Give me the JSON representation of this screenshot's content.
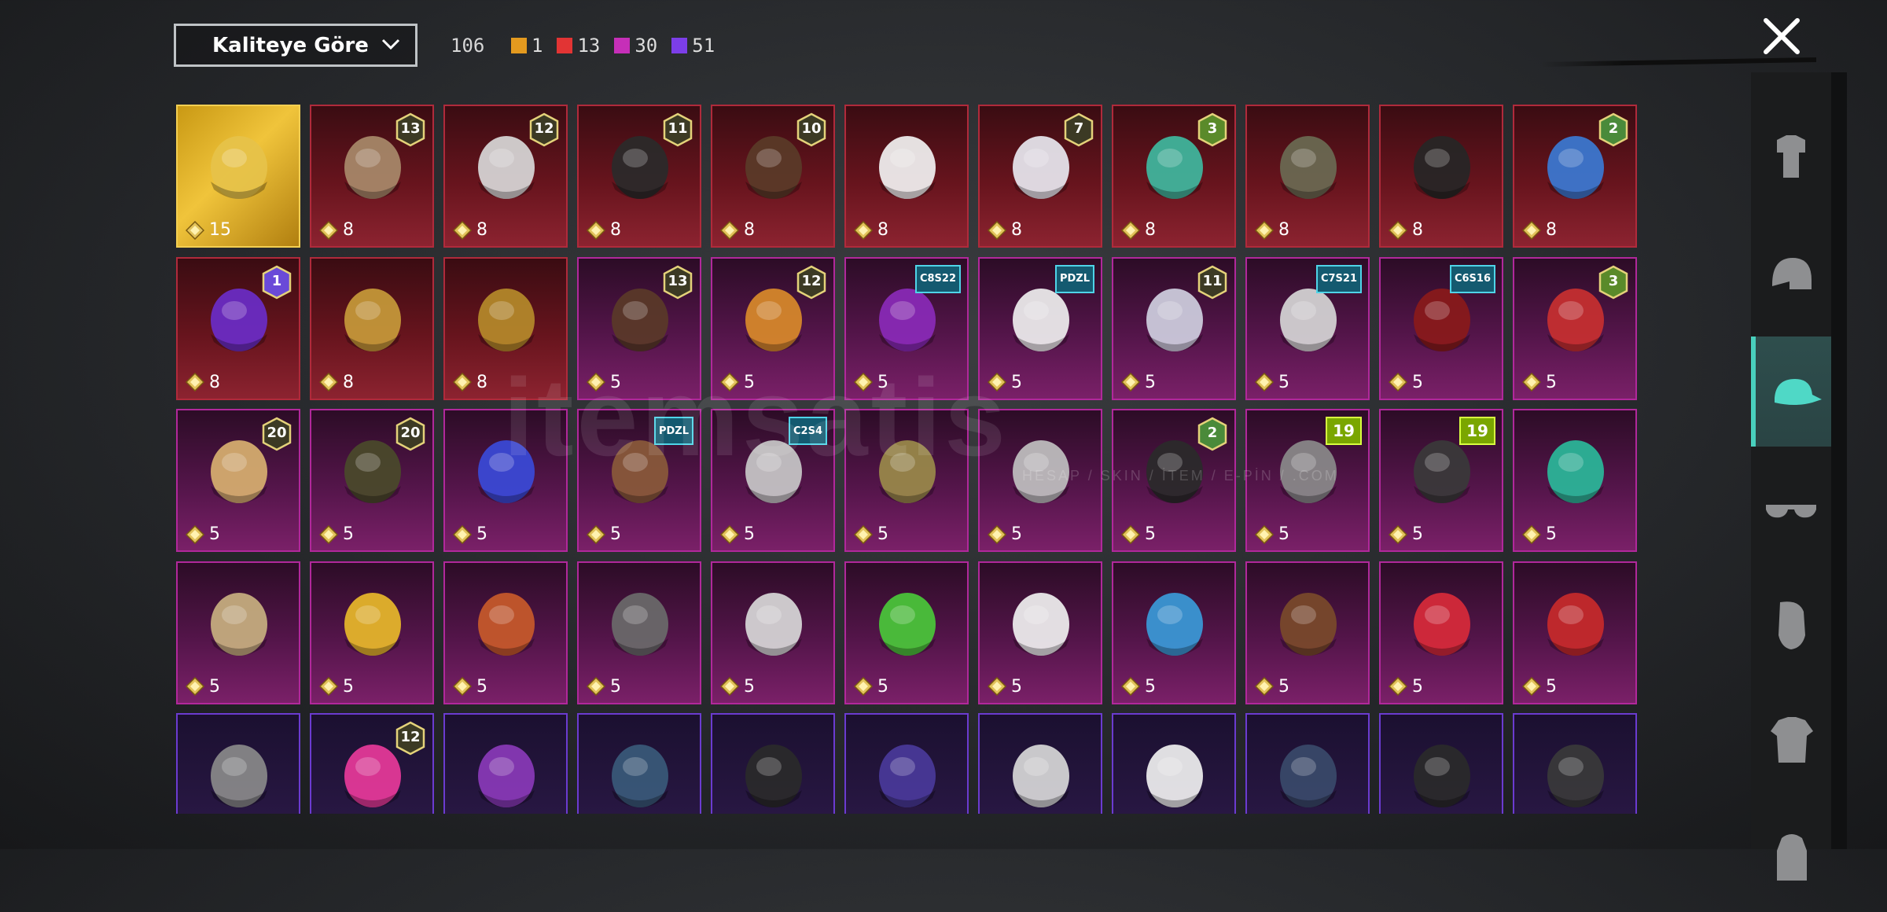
{
  "filter": {
    "sort_label": "Kaliteye Göre",
    "total": "106"
  },
  "legend": [
    {
      "color": "#e49a1f",
      "count": "1"
    },
    {
      "color": "#e23434",
      "count": "13"
    },
    {
      "color": "#c62fb8",
      "count": "30"
    },
    {
      "color": "#7c3ee8",
      "count": "51"
    }
  ],
  "watermark": {
    "text": "itemsatis",
    "sub": "HESAP / SKIN / İTEM / E-PİN / .COM"
  },
  "items": [
    {
      "r": "gold",
      "n": "15",
      "b": "",
      "t": "",
      "icon": "legendary-hat-icon",
      "tint": "#e6c24a"
    },
    {
      "r": "red",
      "n": "8",
      "b": "13",
      "t": "",
      "icon": "hat-with-hair-icon",
      "tint": "#a88a6a"
    },
    {
      "r": "red",
      "n": "8",
      "b": "12",
      "t": "",
      "icon": "white-hair-icon",
      "tint": "#d8d8d8"
    },
    {
      "r": "red",
      "n": "8",
      "b": "11",
      "t": "",
      "icon": "black-helmet-icon",
      "tint": "#2a2a2a"
    },
    {
      "r": "red",
      "n": "8",
      "b": "10",
      "t": "",
      "icon": "brown-hair-icon",
      "tint": "#5a3b28"
    },
    {
      "r": "red",
      "n": "8",
      "b": "",
      "t": "",
      "icon": "cowboy-hat-icon",
      "tint": "#f2f2f2"
    },
    {
      "r": "red",
      "n": "8",
      "b": "7",
      "t": "",
      "icon": "white-hair-icon",
      "tint": "#e8e8f0"
    },
    {
      "r": "red",
      "n": "8",
      "b": "3",
      "t": "",
      "icon": "green-hair-mask-icon",
      "tint": "#3fb8a0"
    },
    {
      "r": "red",
      "n": "8",
      "b": "",
      "t": "",
      "icon": "horned-helmet-icon",
      "tint": "#6a6a52"
    },
    {
      "r": "red",
      "n": "8",
      "b": "",
      "t": "",
      "icon": "dark-helmet-icon",
      "tint": "#262626"
    },
    {
      "r": "red",
      "n": "8",
      "b": "2",
      "t": "",
      "icon": "blue-helmet-icon",
      "tint": "#3b7ad4"
    },
    {
      "r": "red",
      "n": "8",
      "b": "1",
      "t": "",
      "icon": "purple-mask-icon",
      "tint": "#6a2cc8"
    },
    {
      "r": "red",
      "n": "8",
      "b": "",
      "t": "",
      "icon": "gold-helmet-icon",
      "tint": "#c79a3a"
    },
    {
      "r": "red",
      "n": "8",
      "b": "",
      "t": "",
      "icon": "gold-helmet-icon",
      "tint": "#b58a2a"
    },
    {
      "r": "pink",
      "n": "5",
      "b": "13",
      "t": "",
      "icon": "goggles-hat-icon",
      "tint": "#5a3a28"
    },
    {
      "r": "pink",
      "n": "5",
      "b": "12",
      "t": "",
      "icon": "orange-hair-icon",
      "tint": "#d98a2a"
    },
    {
      "r": "pink",
      "n": "5",
      "b": "",
      "t": "C8S22",
      "icon": "purple-hair-icon",
      "tint": "#8a2ab8"
    },
    {
      "r": "pink",
      "n": "5",
      "b": "",
      "t": "PDZL",
      "icon": "panda-mask-icon",
      "tint": "#efefef"
    },
    {
      "r": "pink",
      "n": "5",
      "b": "11",
      "t": "",
      "icon": "flower-hair-icon",
      "tint": "#cfcfdf"
    },
    {
      "r": "pink",
      "n": "5",
      "b": "",
      "t": "C7S21",
      "icon": "silver-hair-icon",
      "tint": "#d6d6d6"
    },
    {
      "r": "pink",
      "n": "5",
      "b": "",
      "t": "C6S16",
      "icon": "red-hair-icon",
      "tint": "#8a1a1a"
    },
    {
      "r": "pink",
      "n": "5",
      "b": "3",
      "t": "",
      "icon": "jester-hat-icon",
      "tint": "#c83030"
    },
    {
      "r": "pink",
      "n": "5",
      "b": "20",
      "t": "",
      "icon": "blonde-hair-icon",
      "tint": "#d8b070"
    },
    {
      "r": "pink",
      "n": "5",
      "b": "20",
      "t": "",
      "icon": "gold-mask-icon",
      "tint": "#4a4a2a"
    },
    {
      "r": "pink",
      "n": "5",
      "b": "",
      "t": "",
      "icon": "blue-beast-mask-icon",
      "tint": "#3a4ad8"
    },
    {
      "r": "pink",
      "n": "5",
      "b": "",
      "t": "PDZL",
      "icon": "gas-mask-icon",
      "tint": "#8a5a3a"
    },
    {
      "r": "pink",
      "n": "5",
      "b": "",
      "t": "C2S4",
      "icon": "silver-hair-icon",
      "tint": "#c8c8c8"
    },
    {
      "r": "pink",
      "n": "5",
      "b": "",
      "t": "",
      "icon": "brass-helmet-icon",
      "tint": "#9a8a4a"
    },
    {
      "r": "pink",
      "n": "5",
      "b": "",
      "t": "",
      "icon": "grey-hair-icon",
      "tint": "#c0c0c0"
    },
    {
      "r": "pink",
      "n": "5",
      "b": "2",
      "t": "",
      "icon": "tentacle-mask-icon",
      "tint": "#2a2a2a"
    },
    {
      "r": "pink",
      "n": "5",
      "b": "",
      "t": "19",
      "icon": "grey-hair-icon",
      "tint": "#8a8a8a"
    },
    {
      "r": "pink",
      "n": "5",
      "b": "",
      "t": "19",
      "icon": "goggle-helmet-icon",
      "tint": "#3a3a3a"
    },
    {
      "r": "pink",
      "n": "5",
      "b": "",
      "t": "",
      "icon": "teal-hat-icon",
      "tint": "#2ab89a"
    },
    {
      "r": "pink",
      "n": "5",
      "b": "",
      "t": "",
      "icon": "gold-mask-icon",
      "tint": "#c8b080"
    },
    {
      "r": "pink",
      "n": "5",
      "b": "",
      "t": "",
      "icon": "yellow-helmet-icon",
      "tint": "#e8b82a"
    },
    {
      "r": "pink",
      "n": "5",
      "b": "",
      "t": "",
      "icon": "bandana-icon",
      "tint": "#c85a2a"
    },
    {
      "r": "pink",
      "n": "5",
      "b": "",
      "t": "",
      "icon": "skull-dreadlocks-icon",
      "tint": "#6a6a6a"
    },
    {
      "r": "pink",
      "n": "5",
      "b": "",
      "t": "",
      "icon": "jester-mask-icon",
      "tint": "#d8d8d8"
    },
    {
      "r": "pink",
      "n": "5",
      "b": "",
      "t": "",
      "icon": "frog-mask-icon",
      "tint": "#4ac83a"
    },
    {
      "r": "pink",
      "n": "5",
      "b": "",
      "t": "",
      "icon": "beanie-icon",
      "tint": "#f0f0f0"
    },
    {
      "r": "pink",
      "n": "5",
      "b": "",
      "t": "",
      "icon": "blue-feather-mask-icon",
      "tint": "#3a9ad8"
    },
    {
      "r": "pink",
      "n": "5",
      "b": "",
      "t": "",
      "icon": "horns-headband-icon",
      "tint": "#7a4a2a"
    },
    {
      "r": "pink",
      "n": "5",
      "b": "",
      "t": "",
      "icon": "devil-horns-icon",
      "tint": "#d82a3a"
    },
    {
      "r": "pink",
      "n": "5",
      "b": "",
      "t": "",
      "icon": "top-hat-icon",
      "tint": "#c82a2a"
    },
    {
      "r": "purple",
      "n": "",
      "b": "",
      "t": "",
      "icon": "grey-hair-icon",
      "tint": "#8a8a8a"
    },
    {
      "r": "purple",
      "n": "",
      "b": "12",
      "t": "",
      "icon": "bunny-ears-icon",
      "tint": "#e83a9a"
    },
    {
      "r": "purple",
      "n": "",
      "b": "",
      "t": "",
      "icon": "antlers-headband-icon",
      "tint": "#8a3ab8"
    },
    {
      "r": "purple",
      "n": "",
      "b": "",
      "t": "",
      "icon": "gas-mask-helmet-icon",
      "tint": "#3a5a7a"
    },
    {
      "r": "purple",
      "n": "",
      "b": "",
      "t": "",
      "icon": "visor-helmet-icon",
      "tint": "#2a2a2a"
    },
    {
      "r": "purple",
      "n": "",
      "b": "",
      "t": "",
      "icon": "purple-hair-icon",
      "tint": "#4a3a9a"
    },
    {
      "r": "purple",
      "n": "",
      "b": "",
      "t": "",
      "icon": "viking-helmet-icon",
      "tint": "#d8d8d8"
    },
    {
      "r": "purple",
      "n": "",
      "b": "",
      "t": "",
      "icon": "sun-hat-icon",
      "tint": "#f0f0f0"
    },
    {
      "r": "purple",
      "n": "",
      "b": "",
      "t": "",
      "icon": "beanie-icon",
      "tint": "#3a4a6a"
    },
    {
      "r": "purple",
      "n": "",
      "b": "",
      "t": "",
      "icon": "cap-icon",
      "tint": "#2a2a2a"
    },
    {
      "r": "purple",
      "n": "",
      "b": "",
      "t": "",
      "icon": "bucket-hat-icon",
      "tint": "#3a3a3a"
    }
  ],
  "sidebar": [
    {
      "name": "outfit-category-icon",
      "selected": false
    },
    {
      "name": "helmet-category-icon",
      "selected": false
    },
    {
      "name": "cap-category-icon",
      "selected": true
    },
    {
      "name": "glasses-category-icon",
      "selected": false
    },
    {
      "name": "mask-category-icon",
      "selected": false
    },
    {
      "name": "jacket-category-icon",
      "selected": false
    },
    {
      "name": "backpack-category-icon",
      "selected": false
    }
  ]
}
